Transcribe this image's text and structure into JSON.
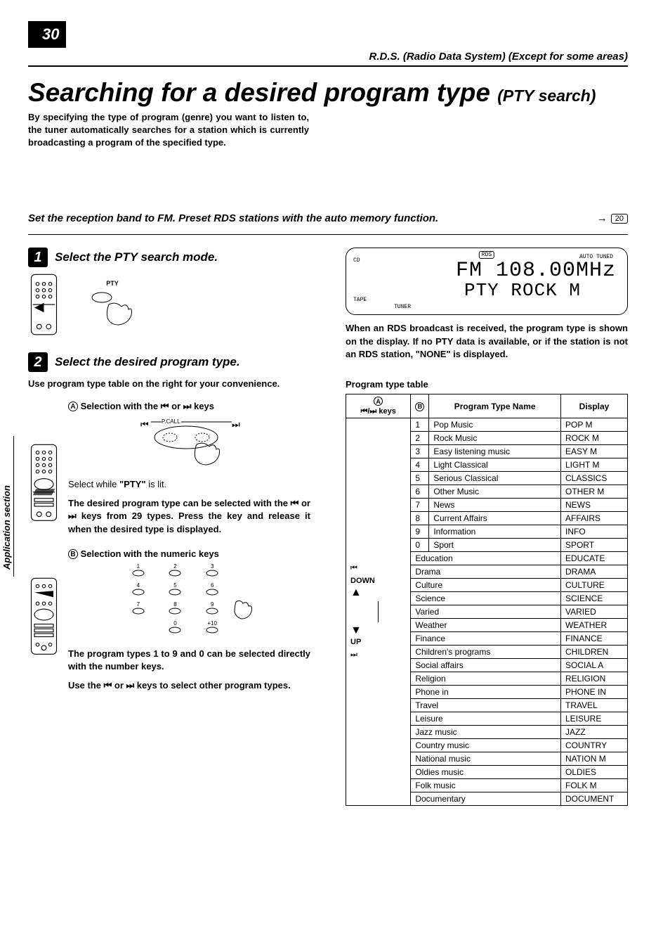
{
  "page_number": "30",
  "running_header": "R.D.S. (Radio Data System) (Except for some areas)",
  "side_tab": "Application section",
  "title_main": "Searching for a desired program type",
  "title_sub": "(PTY search)",
  "intro": "By specifying the type of program (genre) you want to listen to, the tuner automatically searches for a station which is currently broadcasting a program of the specified type.",
  "prereq_text": "Set the reception band to FM.  Preset RDS stations with the auto memory function.",
  "page_ref": "20",
  "steps": {
    "s1": {
      "num": "1",
      "title": "Select the PTY search mode.",
      "pty_label": "PTY"
    },
    "s2": {
      "num": "2",
      "title": "Select the desired program type.",
      "body": "Use program type table on the right for your convenience.",
      "subA": {
        "heading_prefix": "Selection with the ",
        "heading_suffix": " keys",
        "pcall": "P.CALL",
        "line1_pre": "Select while ",
        "line1_bold": "\"PTY\"",
        "line1_post": " is lit.",
        "para": "The desired program type can be selected with the ⏮ or ⏭ keys from 29 types. Press the key and release it when the desired type is displayed."
      },
      "subB": {
        "heading": "Selection with the numeric keys",
        "para1": "The program types 1 to 9 and 0 can be selected directly with the number keys.",
        "para2": "Use the ⏮ or ⏭ keys to select other program types.",
        "key_labels": [
          "1",
          "2",
          "3",
          "4",
          "5",
          "6",
          "7",
          "8",
          "9",
          "0",
          "+10"
        ]
      }
    }
  },
  "display": {
    "cd": "CD",
    "tape": "TAPE",
    "tuner": "TUNER",
    "rds": "RDS",
    "auto_tuned": "AUTO  TUNED",
    "line1": "FM 108.00MHz",
    "line2": "PTY ROCK M"
  },
  "right_note": "When an RDS broadcast is received, the program type is shown on the display. If no PTY data is available, or if the station is not an RDS station, \"NONE\" is displayed.",
  "table": {
    "caption": "Program type table",
    "colA_label": "⏮/⏭ keys",
    "colA_top_sym": "⏮",
    "colA_down": "DOWN",
    "colA_up": "UP",
    "colA_bot_sym": "⏭",
    "colB_header": "Program Type Name",
    "colC_header": "Display",
    "rows": [
      {
        "n": "1",
        "name": "Pop Music",
        "disp": "POP M"
      },
      {
        "n": "2",
        "name": "Rock Music",
        "disp": "ROCK M"
      },
      {
        "n": "3",
        "name": "Easy listening music",
        "disp": "EASY M"
      },
      {
        "n": "4",
        "name": "Light Classical",
        "disp": "LIGHT M"
      },
      {
        "n": "5",
        "name": "Serious Classical",
        "disp": "CLASSICS"
      },
      {
        "n": "6",
        "name": "Other Music",
        "disp": "OTHER M"
      },
      {
        "n": "7",
        "name": "News",
        "disp": "NEWS"
      },
      {
        "n": "8",
        "name": "Current Affairs",
        "disp": "AFFAIRS"
      },
      {
        "n": "9",
        "name": "Information",
        "disp": "INFO"
      },
      {
        "n": "0",
        "name": "Sport",
        "disp": "SPORT"
      },
      {
        "n": "",
        "name": "Education",
        "disp": "EDUCATE"
      },
      {
        "n": "",
        "name": "Drama",
        "disp": "DRAMA"
      },
      {
        "n": "",
        "name": "Culture",
        "disp": "CULTURE"
      },
      {
        "n": "",
        "name": "Science",
        "disp": "SCIENCE"
      },
      {
        "n": "",
        "name": "Varied",
        "disp": "VARIED"
      },
      {
        "n": "",
        "name": "Weather",
        "disp": "WEATHER"
      },
      {
        "n": "",
        "name": "Finance",
        "disp": "FINANCE"
      },
      {
        "n": "",
        "name": "Children's programs",
        "disp": "CHILDREN"
      },
      {
        "n": "",
        "name": "Social affairs",
        "disp": "SOCIAL A"
      },
      {
        "n": "",
        "name": "Religion",
        "disp": "RELIGION"
      },
      {
        "n": "",
        "name": "Phone in",
        "disp": "PHONE IN"
      },
      {
        "n": "",
        "name": "Travel",
        "disp": "TRAVEL"
      },
      {
        "n": "",
        "name": "Leisure",
        "disp": "LEISURE"
      },
      {
        "n": "",
        "name": "Jazz music",
        "disp": "JAZZ"
      },
      {
        "n": "",
        "name": "Country music",
        "disp": "COUNTRY"
      },
      {
        "n": "",
        "name": "National music",
        "disp": "NATION M"
      },
      {
        "n": "",
        "name": "Oldies music",
        "disp": "OLDIES"
      },
      {
        "n": "",
        "name": "Folk music",
        "disp": "FOLK M"
      },
      {
        "n": "",
        "name": "Documentary",
        "disp": "DOCUMENT"
      }
    ]
  }
}
